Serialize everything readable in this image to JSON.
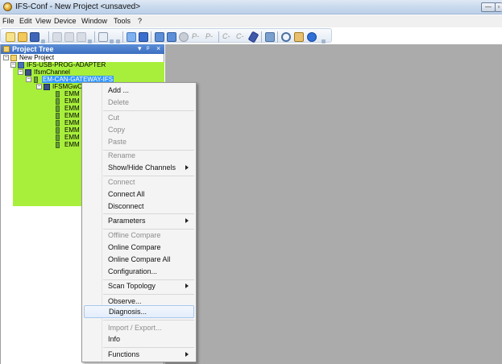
{
  "window": {
    "title": "IFS-Conf - New Project  <unsaved>",
    "minimize_glyph": "—",
    "maximize_glyph": "▫"
  },
  "menu": [
    "File",
    "Edit",
    "View",
    "Device",
    "Window",
    "Tools",
    "?"
  ],
  "toolbar": {
    "text_items": [
      "P-",
      "P-",
      "C-",
      "C-"
    ]
  },
  "project_tree": {
    "title": "Project Tree",
    "controls": [
      "▾",
      "ᵖ",
      "×"
    ],
    "nodes": [
      {
        "label": "New Project",
        "level": 0
      },
      {
        "label": "IFS-USB-PROG-ADAPTER",
        "level": 1
      },
      {
        "label": "IfsmChannel",
        "level": 2
      },
      {
        "label": "EM-CAN-GATEWAY-IFS",
        "level": 3,
        "selected": true
      },
      {
        "label": "IFSMGwC",
        "level": 4
      },
      {
        "label": "EMM",
        "level": 5
      },
      {
        "label": "EMM",
        "level": 5
      },
      {
        "label": "EMM",
        "level": 5
      },
      {
        "label": "EMM",
        "level": 5
      },
      {
        "label": "EMM",
        "level": 5
      },
      {
        "label": "EMM",
        "level": 5
      },
      {
        "label": "EMM",
        "level": 5
      },
      {
        "label": "EMM",
        "level": 5
      }
    ]
  },
  "context_menu": {
    "items": [
      {
        "label": "Add ...",
        "enabled": true
      },
      {
        "label": "Delete",
        "enabled": false
      },
      {
        "label": "Cut",
        "enabled": false
      },
      {
        "label": "Copy",
        "enabled": false
      },
      {
        "label": "Paste",
        "enabled": false
      },
      {
        "label": "Rename",
        "enabled": false
      },
      {
        "label": "Show/Hide Channels",
        "enabled": true,
        "submenu": true
      },
      {
        "label": "Connect",
        "enabled": false
      },
      {
        "label": "Connect All",
        "enabled": true
      },
      {
        "label": "Disconnect",
        "enabled": true
      },
      {
        "label": "Parameters",
        "enabled": true,
        "submenu": true
      },
      {
        "label": "Offline Compare",
        "enabled": false
      },
      {
        "label": "Online Compare",
        "enabled": true
      },
      {
        "label": "Online Compare All",
        "enabled": true
      },
      {
        "label": "Configuration...",
        "enabled": true
      },
      {
        "label": "Scan Topology",
        "enabled": true,
        "submenu": true
      },
      {
        "label": "Observe...",
        "enabled": true
      },
      {
        "label": "Diagnosis...",
        "enabled": true,
        "hovered": true
      },
      {
        "label": "Import / Export...",
        "enabled": false
      },
      {
        "label": "Info",
        "enabled": true
      },
      {
        "label": "Functions",
        "enabled": true,
        "submenu": true
      }
    ]
  },
  "colors": {
    "tree_highlight": "#a8ef3c",
    "workspace": "#ababab",
    "selection": "#3399ff",
    "panel_header": "#3c6fc0"
  }
}
